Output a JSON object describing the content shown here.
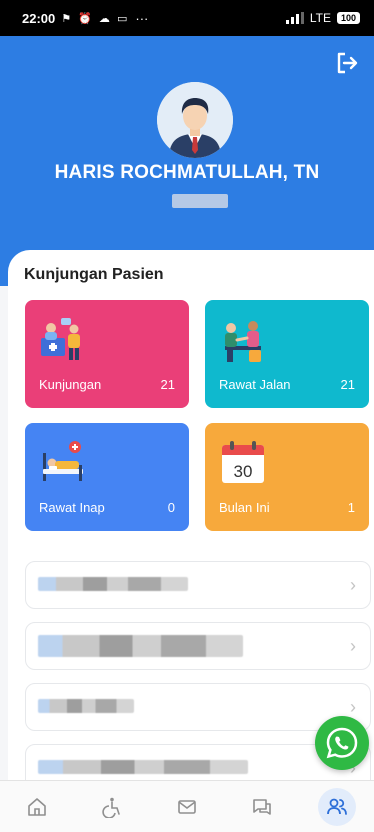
{
  "status_bar": {
    "time": "22:00",
    "dots": "···",
    "network": "LTE",
    "battery": "100"
  },
  "header": {
    "user_name": "HARIS ROCHMATULLAH, TN",
    "background_color": "#2d7de3"
  },
  "section": {
    "title": "Kunjungan Pasien"
  },
  "cards": [
    {
      "label": "Kunjungan",
      "value": "21",
      "color": "#ea3f78",
      "icon": "doctor-patient-icon"
    },
    {
      "label": "Rawat Jalan",
      "value": "21",
      "color": "#0fb9ce",
      "icon": "consultation-icon"
    },
    {
      "label": "Rawat Inap",
      "value": "0",
      "color": "#4584f3",
      "icon": "hospital-bed-icon"
    },
    {
      "label": "Bulan Ini",
      "value": "1",
      "color": "#f7a93c",
      "icon": "calendar-icon",
      "calendar_day": "30"
    }
  ],
  "menu": {
    "chevron": "›"
  },
  "bottom_nav": {
    "items": [
      "home-icon",
      "accessibility-icon",
      "mail-icon",
      "chat-icon",
      "users-icon"
    ],
    "active": "users-icon"
  }
}
